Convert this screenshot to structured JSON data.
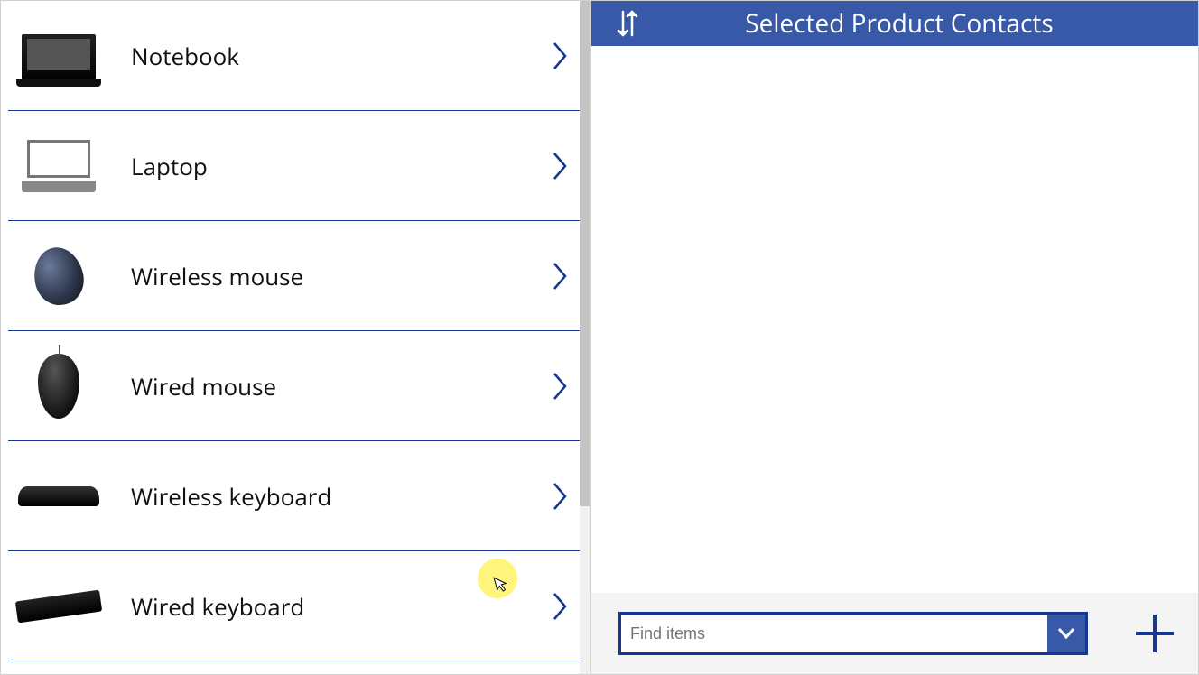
{
  "colors": {
    "accent": "#17368f",
    "header": "#3858a8"
  },
  "products": [
    {
      "label": "Notebook",
      "icon": "notebook-icon"
    },
    {
      "label": "Laptop",
      "icon": "laptop-icon"
    },
    {
      "label": "Wireless mouse",
      "icon": "wireless-mouse-icon"
    },
    {
      "label": "Wired mouse",
      "icon": "wired-mouse-icon"
    },
    {
      "label": "Wireless keyboard",
      "icon": "wireless-keyboard-icon"
    },
    {
      "label": "Wired keyboard",
      "icon": "wired-keyboard-icon"
    }
  ],
  "right": {
    "title": "Selected Product Contacts",
    "find_placeholder": "Find items"
  }
}
